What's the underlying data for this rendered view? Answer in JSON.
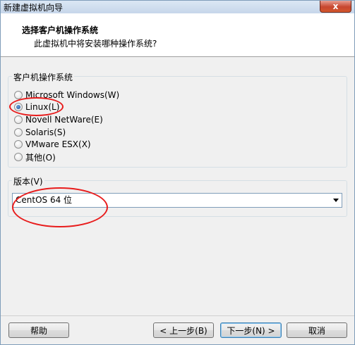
{
  "window": {
    "title": "新建虚拟机向导",
    "close_label": "x"
  },
  "header": {
    "title": "选择客户机操作系统",
    "subtitle": "此虚拟机中将安装哪种操作系统?"
  },
  "os_group": {
    "label": "客户机操作系统",
    "options": [
      {
        "label": "Microsoft Windows(W)",
        "checked": false
      },
      {
        "label": "Linux(L)",
        "checked": true
      },
      {
        "label": "Novell NetWare(E)",
        "checked": false
      },
      {
        "label": "Solaris(S)",
        "checked": false
      },
      {
        "label": "VMware ESX(X)",
        "checked": false
      },
      {
        "label": "其他(O)",
        "checked": false
      }
    ]
  },
  "version_group": {
    "label": "版本(V)",
    "selected": "CentOS 64 位"
  },
  "buttons": {
    "help": "帮助",
    "back": "< 上一步(B)",
    "next": "下一步(N) >",
    "cancel": "取消"
  },
  "colors": {
    "annotation": "#e81c1c",
    "accent": "#3c7fb1"
  }
}
